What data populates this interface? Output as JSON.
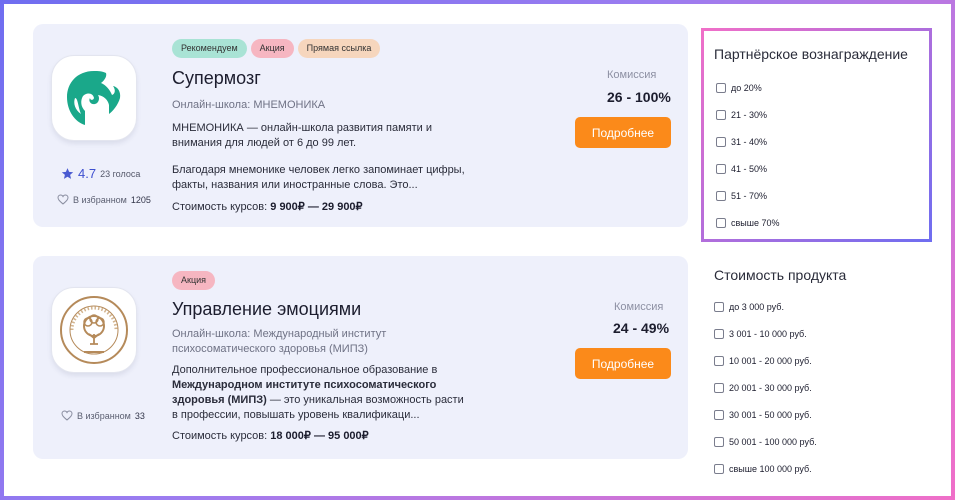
{
  "cards": [
    {
      "tags": [
        "Рекомендуем",
        "Акция",
        "Прямая ссылка"
      ],
      "title": "Супермозг",
      "school": "Онлайн-школа: МНЕМОНИКА",
      "desc1": "МНЕМОНИКА — онлайн-школа развития памяти и внимания для людей от 6 до 99 лет.",
      "desc2": "Благодаря мнемонике человек легко запоминает цифры, факты, названия или иностранные слова. Это...",
      "price_label": "Стоимость курсов:",
      "price_value": "9 900₽ — 29 900₽",
      "rating": "4.7",
      "votes": "23 голоса",
      "fav_label": "В избранном",
      "fav_count": "1205",
      "commission_label": "Комиссия",
      "commission_value": "26 - 100%",
      "button": "Подробнее",
      "colors": {
        "logo": "#1aa88a"
      }
    },
    {
      "tags": [
        "Акция"
      ],
      "title": "Управление эмоциями",
      "school": "Онлайн-школа: Международный институт психосоматического здоровья (МИПЗ)",
      "desc_a": "Дополнительное профессиональное образование в ",
      "desc_bold": "Международном институте психосоматического здоровья (МИПЗ)",
      "desc_b": " — это уникальная возможность расти в профессии, повышать уровень квалификаци...",
      "price_label": "Стоимость курсов:",
      "price_value": "18 000₽ — 95 000₽",
      "fav_label": "В избранном",
      "fav_count": "33",
      "commission_label": "Комиссия",
      "commission_value": "24 - 49%",
      "button": "Подробнее",
      "colors": {
        "logo": "#b58a5a"
      }
    }
  ],
  "filters": {
    "reward": {
      "title": "Партнёрское вознаграждение",
      "options": [
        "до 20%",
        "21 - 30%",
        "31 - 40%",
        "41 - 50%",
        "51 - 70%",
        "свыше 70%"
      ]
    },
    "price": {
      "title": "Стоимость продукта",
      "options": [
        "до 3 000 руб.",
        "3 001 - 10 000 руб.",
        "10 001 - 20 000 руб.",
        "20 001 - 30 000 руб.",
        "30 001 - 50 000 руб.",
        "50 001 - 100 000 руб.",
        "свыше 100 000 руб."
      ]
    }
  },
  "colors": {
    "accent": "#fb8a1a",
    "star": "#4a5bd1",
    "card_bg": "#eef0fb"
  },
  "icons": [
    "star-icon",
    "heart-icon",
    "checkbox-icon"
  ]
}
